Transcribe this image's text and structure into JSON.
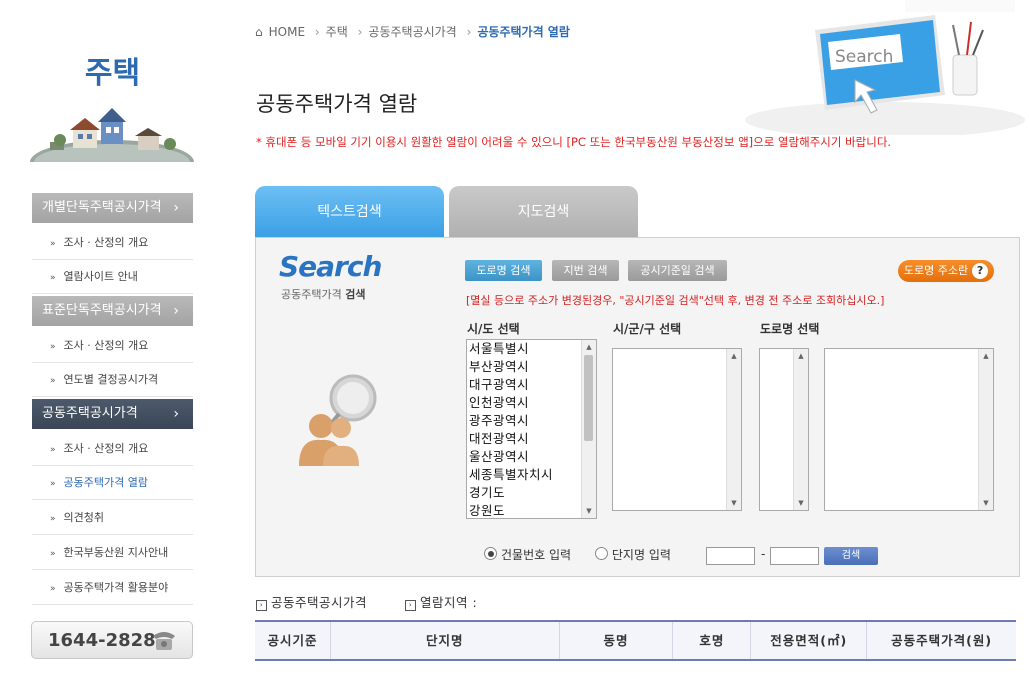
{
  "sidebar": {
    "title": "주택",
    "categories": [
      {
        "label": "개별단독주택공시가격",
        "items": [
          "조사 · 산정의 개요",
          "열람사이트 안내"
        ]
      },
      {
        "label": "표준단독주택공시가격",
        "items": [
          "조사 · 산정의 개요",
          "연도별 결정공시가격"
        ]
      },
      {
        "label": "공동주택공시가격",
        "items": [
          "조사 · 산정의 개요",
          "공동주택가격 열람",
          "의견청취",
          "한국부동산원 지사안내",
          "공동주택가격 활용분야"
        ]
      }
    ],
    "phone": "1644-2828"
  },
  "breadcrumb": [
    "HOME",
    "주택",
    "공동주택공시가격",
    "공동주택가격 열람"
  ],
  "page_title": "공동주택가격 열람",
  "notice": "* 휴대폰 등 모바일 기기 이용시 원활한 열람이 어려울 수 있으니 [PC 또는 한국부동산원 부동산정보 앱]으로 열람해주시기 바랍니다.",
  "header_illust_text": "Search",
  "tabs": [
    "텍스트검색",
    "지도검색"
  ],
  "panel": {
    "logo": "Search",
    "subtitle_prefix": "공동주택가격 ",
    "subtitle_bold": "검색",
    "buttons": {
      "road": "도로명 검색",
      "jibun": "지번 검색",
      "date": "공시기준일 검색",
      "help": "도로명 주소란",
      "search": "검색"
    },
    "notice": "[멸실 등으로 주소가 변경된경우, \"공시기준일 검색\"선택 후, 변경 전 주소로 조회하십시오.]",
    "labels": {
      "sido": "시/도 선택",
      "sigungu": "시/군/구 선택",
      "road": "도로명 선택"
    },
    "sido_options": [
      "서울특별시",
      "부산광역시",
      "대구광역시",
      "인천광역시",
      "광주광역시",
      "대전광역시",
      "울산광역시",
      "세종특별자치시",
      "경기도",
      "강원도"
    ],
    "radio_building": "건물번호 입력",
    "radio_unit": "단지명 입력",
    "dash": "-"
  },
  "results": {
    "price_label": "공동주택공시가격",
    "region_label": "열람지역 :",
    "columns": [
      "공시기준",
      "단지명",
      "동명",
      "호명",
      "전용면적(㎡)",
      "공동주택가격(원)"
    ]
  },
  "colors": {
    "accent": "#2d6bb0",
    "tab_active": "#3a9fe6",
    "notice": "#e02020",
    "help_button": "#e46f0c"
  }
}
